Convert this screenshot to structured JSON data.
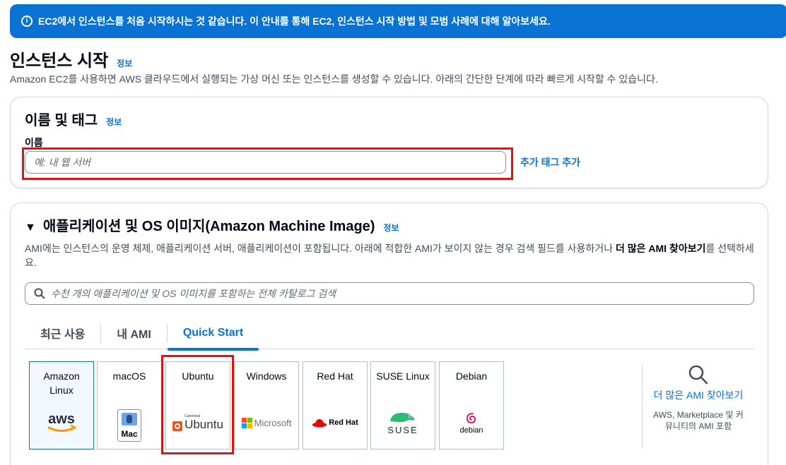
{
  "banner": {
    "text": "EC2에서 인스턴스를 처음 시작하시는 것 같습니다. 이 안내를 통해 EC2, 인스턴스 시작 방법 및 모범 사례에 대해 알아보세요.",
    "icon": "info-icon",
    "color": "#0972d3"
  },
  "page": {
    "title": "인스턴스 시작",
    "info": "정보",
    "description": "Amazon EC2를 사용하면 AWS 클라우드에서 실행되는 가상 머신 또는 인스턴스를 생성할 수 있습니다. 아래의 간단한 단계에 따라 빠르게 시작할 수 있습니다."
  },
  "name_tags": {
    "title": "이름 및 태그",
    "info": "정보",
    "field_label": "이름",
    "placeholder": "예: 내 웹 서버",
    "value": "",
    "add_tags": "추가 태그 추가"
  },
  "ami": {
    "title": "애플리케이션 및 OS 이미지(Amazon Machine Image)",
    "info": "정보",
    "desc_before": "AMI에는 인스턴스의 운영 체제, 애플리케이션 서버, 애플리케이션이 포함됩니다. 아래에 적합한 AMI가 보이지 않는 경우 검색 필드를 사용하거나 ",
    "desc_bold": "더 많은 AMI 찾아보기",
    "desc_after": "를 선택하세요.",
    "search_placeholder": "수천 개의 애플리케이션 및 OS 이미지를 포함하는 전체 카탈로그 검색",
    "tabs": [
      {
        "label": "최근 사용",
        "active": false
      },
      {
        "label": "내 AMI",
        "active": false
      },
      {
        "label": "Quick Start",
        "active": true
      }
    ],
    "os_options": [
      {
        "name": "Amazon Linux",
        "logo": "aws-logo",
        "selected": true
      },
      {
        "name": "macOS",
        "logo": "mac-logo",
        "logo_text": "Mac",
        "selected": false
      },
      {
        "name": "Ubuntu",
        "logo": "ubuntu-logo",
        "logo_small": "Canonical",
        "logo_text": "Ubuntu",
        "selected": false
      },
      {
        "name": "Windows",
        "logo": "microsoft-logo",
        "logo_text": "Microsoft",
        "selected": false
      },
      {
        "name": "Red Hat",
        "logo": "redhat-logo",
        "logo_text": "Red Hat",
        "selected": false
      },
      {
        "name": "SUSE Linux",
        "logo": "suse-logo",
        "logo_text": "SUSE",
        "selected": false
      },
      {
        "name": "Debian",
        "logo": "debian-logo",
        "logo_text": "debian",
        "selected": false
      }
    ],
    "aws_logo_text": "aws",
    "more": {
      "icon": "search-icon",
      "link": "더 많은 AMI 찾아보기",
      "sub": "AWS, Marketplace 및 커뮤니티의 AMI 포함"
    }
  },
  "colors": {
    "accent": "#0972d3",
    "highlight": "#d91515",
    "selected_bg": "#f2f8fd"
  }
}
